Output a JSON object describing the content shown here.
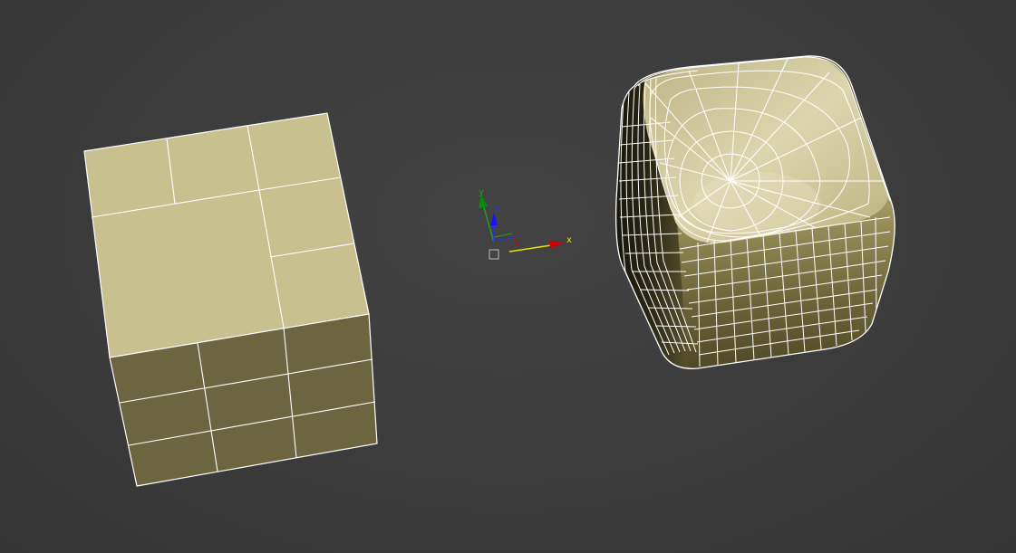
{
  "viewport": {
    "name": "perspective-viewport",
    "objects": [
      {
        "id": "box-quad-mesh",
        "kind": "box"
      },
      {
        "id": "rounded-box-subdivided",
        "kind": "rounded-box"
      }
    ]
  },
  "gizmo": {
    "axes": [
      {
        "key": "x",
        "label": "x",
        "color": "#e8e000"
      },
      {
        "key": "y",
        "label": "y",
        "color": "#1ea01e"
      },
      {
        "key": "z",
        "label": "z",
        "color": "#2a2aff"
      }
    ],
    "colors": {
      "x_arrow": "#d40000",
      "y_arrow": "#0a8a0a",
      "z_arrow": "#1414ff",
      "pivot_square": "#bdbdbd"
    }
  },
  "colors": {
    "background": "#3c3c3c",
    "wire": "#ffffff",
    "top_face": "#c8c08e",
    "front_face": "#6b6540",
    "rounded_light": "#d8d2a6",
    "rounded_dark": "#1a180c"
  }
}
